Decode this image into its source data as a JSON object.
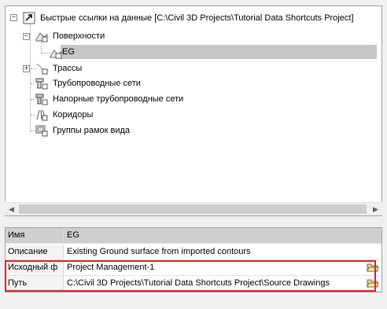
{
  "tree": {
    "root": {
      "label": "Быстрые ссылки на данные [C:\\Civil 3D Projects\\Tutorial Data Shortcuts Project]",
      "icon": "data-shortcuts-icon"
    },
    "surfaces": {
      "label": "Поверхности",
      "icon": "surface-folder-icon",
      "expander": "−"
    },
    "eg": {
      "label": "EG",
      "icon": "surface-icon"
    },
    "alignments": {
      "label": "Трассы",
      "icon": "alignment-icon",
      "expander": "+"
    },
    "pipe_networks": {
      "label": "Трубопроводные сети",
      "icon": "pipe-network-icon"
    },
    "pressure_networks": {
      "label": "Напорные трубопроводные сети",
      "icon": "pressure-network-icon"
    },
    "corridors": {
      "label": "Коридоры",
      "icon": "corridor-icon"
    },
    "view_frames": {
      "label": "Группы рамок вида",
      "icon": "view-frame-icon"
    }
  },
  "grid": {
    "header": {
      "key": "Имя",
      "value": "EG"
    },
    "description": {
      "key": "Описание",
      "value": "Existing Ground surface from imported contours"
    },
    "source": {
      "key": "Исходный ф",
      "value": "Project Management-1"
    },
    "path": {
      "key": "Путь",
      "value": "C:\\Civil 3D Projects\\Tutorial Data Shortcuts Project\\Source Drawings"
    }
  },
  "colors": {
    "selection": "#c6c6c6",
    "highlight": "#dd2222"
  }
}
